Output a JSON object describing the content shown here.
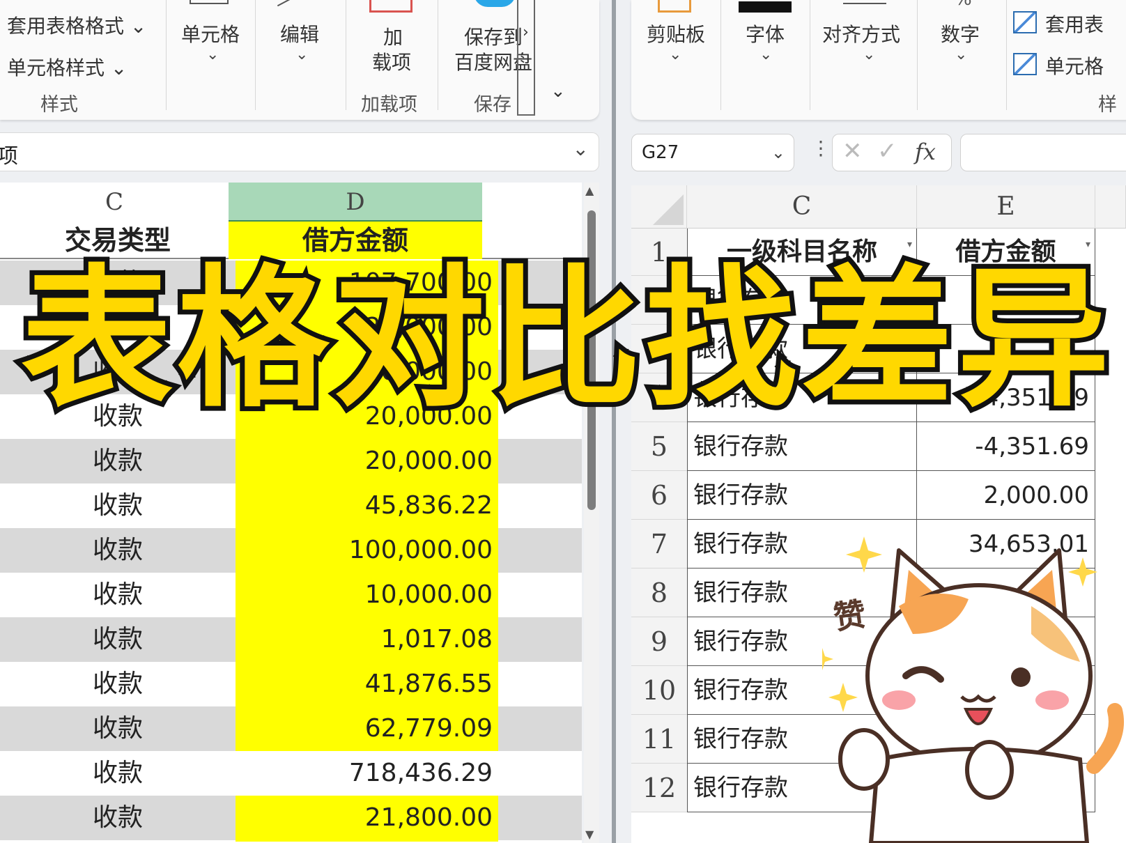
{
  "left_window": {
    "ribbon": {
      "style_items": [
        "套用表格格式",
        "单元格样式"
      ],
      "style_group": "样式",
      "cell_button": "单元格",
      "edit_button": "编辑",
      "addin_button_line1": "加",
      "addin_button_line2": "载项",
      "addin_group": "加载项",
      "save_button_line1": "保存到",
      "save_button_line2": "百度网盘",
      "save_group": "保存"
    },
    "formula_text": "项",
    "columns": {
      "c": "C",
      "d": "D"
    },
    "headers": {
      "c": "交易类型",
      "d": "借方金额"
    },
    "rows": [
      {
        "type": "收款",
        "amount": "107,700.00",
        "shade": "gray",
        "hl": true
      },
      {
        "type": "收款",
        "amount": "20,000.00",
        "shade": "white",
        "hl": true
      },
      {
        "type": "收款",
        "amount": "50,000.00",
        "shade": "gray",
        "hl": true
      },
      {
        "type": "收款",
        "amount": "20,000.00",
        "shade": "white",
        "hl": true
      },
      {
        "type": "收款",
        "amount": "20,000.00",
        "shade": "gray",
        "hl": true
      },
      {
        "type": "收款",
        "amount": "45,836.22",
        "shade": "white",
        "hl": true
      },
      {
        "type": "收款",
        "amount": "100,000.00",
        "shade": "gray",
        "hl": true
      },
      {
        "type": "收款",
        "amount": "10,000.00",
        "shade": "white",
        "hl": true
      },
      {
        "type": "收款",
        "amount": "1,017.08",
        "shade": "gray",
        "hl": true
      },
      {
        "type": "收款",
        "amount": "41,876.55",
        "shade": "white",
        "hl": true
      },
      {
        "type": "收款",
        "amount": "62,779.09",
        "shade": "gray",
        "hl": true
      },
      {
        "type": "收款",
        "amount": "718,436.29",
        "shade": "white",
        "hl": false
      },
      {
        "type": "收款",
        "amount": "21,800.00",
        "shade": "gray",
        "hl": true
      }
    ]
  },
  "right_window": {
    "ribbon": {
      "clipboard": "剪贴板",
      "font": "字体",
      "alignment": "对齐方式",
      "number": "数字",
      "table_format": "套用表",
      "cell_style": "单元格",
      "style_group": "样"
    },
    "name_box": "G27",
    "fx_label": "fx",
    "columns": {
      "c": "C",
      "e": "E"
    },
    "headers": {
      "c": "一级科目名称",
      "e": "借方金额"
    },
    "rows": [
      {
        "num": "2",
        "name": "银行存款",
        "amount": ""
      },
      {
        "num": "3",
        "name": "银行存款",
        "amount": ""
      },
      {
        "num": "4",
        "name": "银行存款",
        "amount": "-4,351.69"
      },
      {
        "num": "5",
        "name": "银行存款",
        "amount": "-4,351.69"
      },
      {
        "num": "6",
        "name": "银行存款",
        "amount": "2,000.00"
      },
      {
        "num": "7",
        "name": "银行存款",
        "amount": "34,653.01"
      },
      {
        "num": "8",
        "name": "银行存款",
        "amount": ""
      },
      {
        "num": "9",
        "name": "银行存款",
        "amount": ""
      },
      {
        "num": "10",
        "name": "银行存款",
        "amount": ""
      },
      {
        "num": "11",
        "name": "银行存款",
        "amount": ""
      },
      {
        "num": "12",
        "name": "银行存款",
        "amount": ""
      }
    ],
    "first_row_num": "1"
  },
  "overlay": {
    "title": "表格对比找差异"
  },
  "sticker": {
    "text": "赞"
  },
  "colors": {
    "highlight": "#ffff00",
    "header_green": "#a8d8b8",
    "row_gray": "#d9d9d9",
    "title_yellow": "#ffd800"
  }
}
